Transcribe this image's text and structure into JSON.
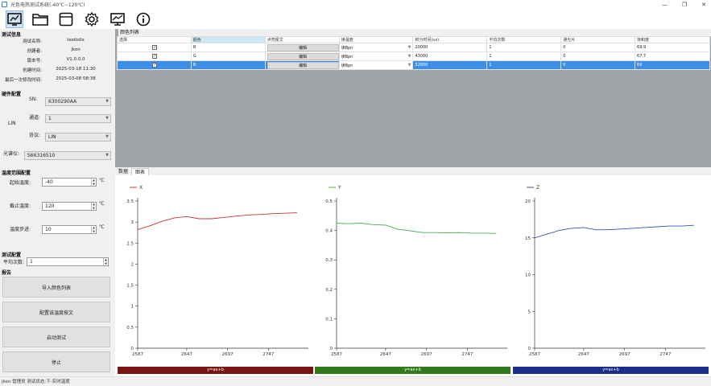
{
  "window": {
    "title": "光色电热测试系统(-40℃~120℃)",
    "minimize": "—",
    "maximize": "❐",
    "close": "✕"
  },
  "toolbar": {
    "icons": [
      "chart-monitor-icon",
      "folder-icon",
      "save-icon",
      "gear-icon",
      "monitor-chart-icon",
      "info-icon"
    ]
  },
  "test_info": {
    "title": "测试信息",
    "rows": [
      {
        "label": "测试名称:",
        "value": "testlolis"
      },
      {
        "label": "创建者:",
        "value": "jkon"
      },
      {
        "label": "版本号:",
        "value": "V1.0.0.0"
      },
      {
        "label": "创建时间:",
        "value": "2025-03-18 11:30"
      },
      {
        "label": "最后一次修改时间:",
        "value": "2025-03-08 08:38"
      }
    ]
  },
  "hardware": {
    "title": "硬件配置",
    "sn_label": "SN:",
    "sn_value": "6300290AA",
    "lin_label": "LIN",
    "channel_label": "通道:",
    "channel_value": "1",
    "protocol_label": "协议:",
    "protocol_value": "LIN",
    "spectrometer_label": "光谱仪:",
    "spectrometer_value": "S66316510"
  },
  "temperature": {
    "title": "温度范围配置",
    "start_label": "起始温度:",
    "start_value": "-40",
    "end_label": "截止温度:",
    "end_value": "120",
    "step_label": "温度步进:",
    "step_value": "10",
    "unit": "℃"
  },
  "test_config": {
    "title": "测试配置",
    "avg_label": "平均次数:",
    "avg_value": "1"
  },
  "report": {
    "title": "报告",
    "buttons": [
      "导入颜色列表",
      "配置该温度按文",
      "启动测试",
      "停止"
    ]
  },
  "color_list": {
    "title": "颜色列表",
    "columns": [
      "选择",
      "颜色",
      "点亮报文",
      "读温度",
      "积分时间(us)",
      "平均次数",
      "通光片",
      "饱和度"
    ],
    "edit_label": "编辑",
    "rows": [
      {
        "checked": true,
        "color": "R",
        "read": "读Bpn",
        "integration": "20000",
        "avg": "1",
        "filter": "0",
        "saturation": "69.9"
      },
      {
        "checked": true,
        "color": "G",
        "read": "读Bpn",
        "integration": "43000",
        "avg": "1",
        "filter": "0",
        "saturation": "67.7"
      },
      {
        "checked": true,
        "color": "B",
        "read": "读Bpn",
        "integration": "52000",
        "avg": "1",
        "filter": "0",
        "saturation": "69"
      }
    ]
  },
  "tabs": [
    "数据",
    "图表"
  ],
  "status": {
    "text": "jkon 管理员   测试状态:下-实时温度"
  },
  "colors": {
    "red": "#7a1414",
    "green": "#2f7a1a",
    "blue": "#1c2d8a",
    "selection": "#3d8ee6"
  },
  "chart_data": [
    {
      "type": "line",
      "series": [
        {
          "name": "X",
          "color": "#c0392b",
          "x": [
            2587,
            2602,
            2617,
            2632,
            2647,
            2662,
            2677,
            2692,
            2707,
            2722,
            2737,
            2752,
            2767,
            2782
          ],
          "y": [
            2.82,
            2.91,
            3.02,
            3.1,
            3.13,
            3.08,
            3.08,
            3.11,
            3.14,
            3.17,
            3.18,
            3.2,
            3.21,
            3.22
          ]
        }
      ],
      "xticks": [
        2587,
        2647,
        2697,
        2747
      ],
      "yticks": [
        0,
        0.5,
        1,
        1.5,
        2,
        2.5,
        3,
        3.5
      ],
      "ylim": [
        0,
        3.5
      ],
      "xlim": [
        2587,
        2792
      ],
      "footer": "y=ax+b"
    },
    {
      "type": "line",
      "series": [
        {
          "name": "Y",
          "color": "#4caf50",
          "x": [
            2587,
            2602,
            2617,
            2632,
            2647,
            2662,
            2677,
            2692,
            2707,
            2722,
            2737,
            2752,
            2767,
            2782
          ],
          "y": [
            0.425,
            0.423,
            0.425,
            0.42,
            0.418,
            0.404,
            0.399,
            0.393,
            0.393,
            0.392,
            0.393,
            0.391,
            0.391,
            0.39
          ]
        }
      ],
      "xticks": [
        2587,
        2647,
        2697,
        2747
      ],
      "yticks": [
        0,
        0.1,
        0.2,
        0.3,
        0.4,
        0.5
      ],
      "ylim": [
        0,
        0.5
      ],
      "xlim": [
        2587,
        2792
      ],
      "footer": "y=ax+b"
    },
    {
      "type": "line",
      "series": [
        {
          "name": "Z",
          "color": "#3f51b5",
          "x": [
            2587,
            2602,
            2617,
            2632,
            2647,
            2662,
            2677,
            2692,
            2707,
            2722,
            2737,
            2752,
            2767,
            2782
          ],
          "y": [
            15.0,
            15.5,
            16.0,
            16.3,
            16.4,
            16.1,
            16.1,
            16.2,
            16.3,
            16.4,
            16.5,
            16.6,
            16.6,
            16.7
          ]
        }
      ],
      "xticks": [
        2587,
        2647,
        2697,
        2747
      ],
      "yticks": [
        0,
        5,
        10,
        15,
        20
      ],
      "ylim": [
        0,
        20
      ],
      "xlim": [
        2587,
        2792
      ],
      "footer": "y=ax+b"
    }
  ]
}
